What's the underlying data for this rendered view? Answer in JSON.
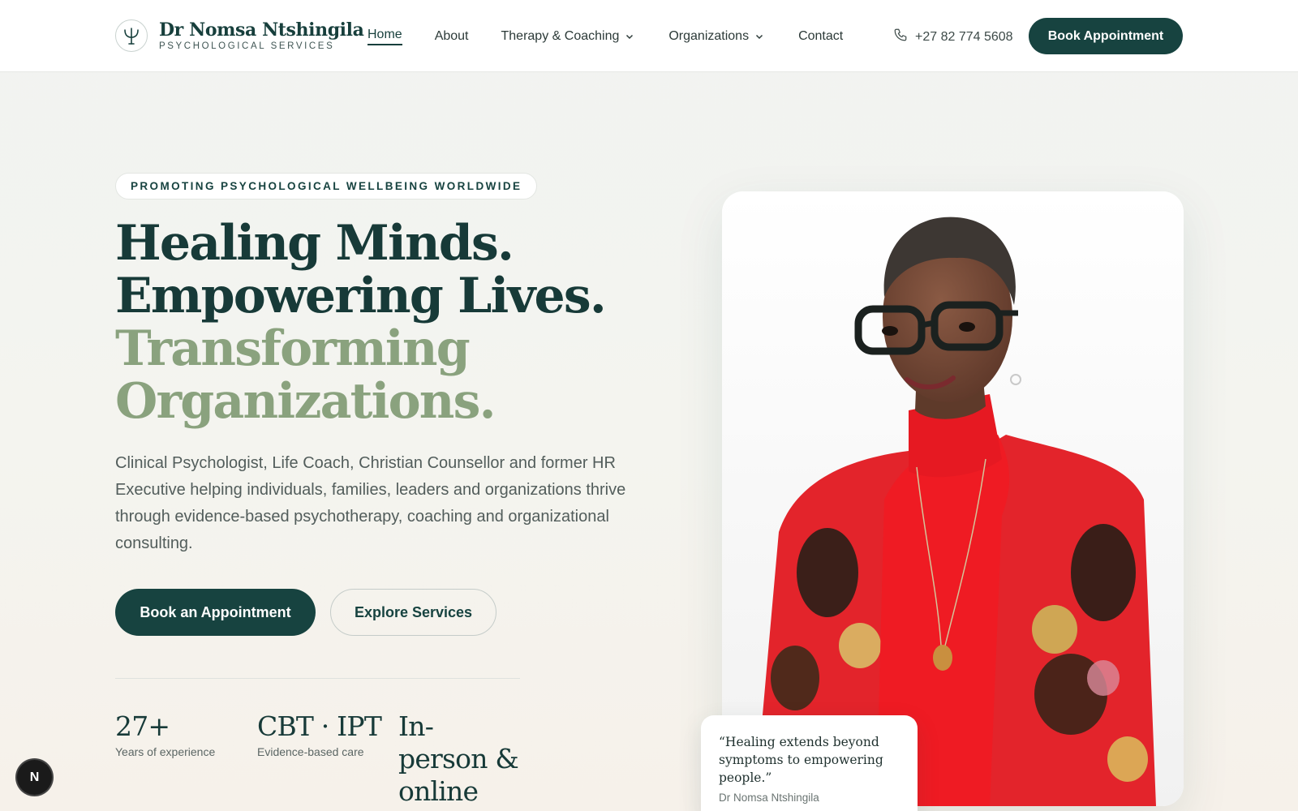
{
  "brand": {
    "name": "Dr Nomsa Ntshingila",
    "subtitle": "PSYCHOLOGICAL SERVICES",
    "logo_icon": "psi-symbol-icon"
  },
  "nav": {
    "items": [
      {
        "label": "Home",
        "active": true
      },
      {
        "label": "About"
      },
      {
        "label": "Therapy & Coaching",
        "dropdown": true
      },
      {
        "label": "Organizations",
        "dropdown": true
      },
      {
        "label": "Contact"
      }
    ],
    "phone": "+27 82 774 5608",
    "phone_icon": "phone-icon",
    "book_label": "Book Appointment"
  },
  "hero": {
    "tagline": "PROMOTING PSYCHOLOGICAL WELLBEING WORLDWIDE",
    "headline": {
      "line1": "Healing Minds.",
      "line2": "Empowering Lives.",
      "line3": "Transforming",
      "line4": "Organizations."
    },
    "intro": "Clinical Psychologist, Life Coach, Christian Counsellor and former HR Executive helping individuals, families, leaders and organizations thrive through evidence-based psychotherapy, coaching and organizational consulting.",
    "primary_cta": "Book an Appointment",
    "secondary_cta": "Explore Services",
    "stats": [
      {
        "value": "27+",
        "label": "Years of experience"
      },
      {
        "value": "CBT · IPT",
        "label": "Evidence-based care"
      },
      {
        "value": "In-person & online",
        "label": ""
      }
    ]
  },
  "portrait": {
    "quote": "“Healing extends beyond symptoms to empowering people.”",
    "author": "Dr Nomsa Ntshingila"
  },
  "floating_badge": "N",
  "colors": {
    "primary": "#174340",
    "accent_sage": "#8aa27e",
    "text": "#1f2d2b"
  }
}
